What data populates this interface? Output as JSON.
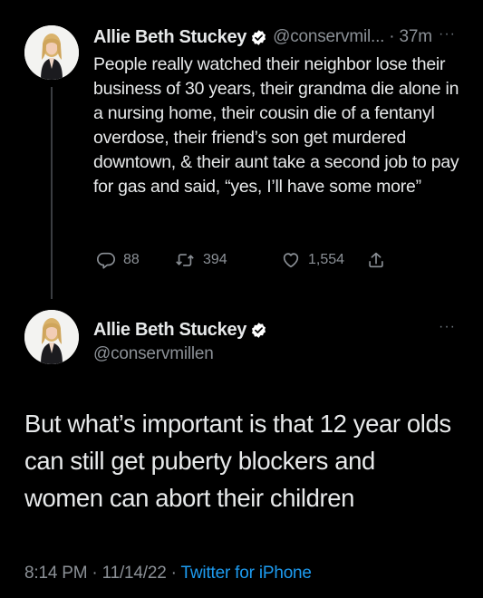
{
  "colors": {
    "background": "#000000",
    "primary_text": "#e7e9ea",
    "secondary_text": "#8b9096",
    "link": "#1d9bf0",
    "verified_badge": "#ffffff",
    "thread_line": "#3a3d41"
  },
  "tweet1": {
    "author_name": "Allie Beth Stuckey",
    "verified_icon": "verified-badge-icon",
    "handle_time": "@conservmil... · 37m",
    "more_label": "···",
    "text": "People really watched their neighbor lose their business of 30 years, their grandma die alone in a nursing home, their cousin die of a fentanyl overdose, their friend’s son get murdered downtown, & their aunt take a second job to pay for gas and said, “yes, I’ll have some more”",
    "actions": {
      "reply_count": "88",
      "retweet_count": "394",
      "like_count": "1,554"
    }
  },
  "tweet2": {
    "author_name": "Allie Beth Stuckey",
    "handle": "@conservmillen",
    "more_label": "···",
    "text": "But what’s important is that 12 year olds can still get puberty blockers and women can abort their children",
    "timestamp": "8:14 PM · 11/14/22 · ",
    "source": "Twitter for iPhone"
  }
}
